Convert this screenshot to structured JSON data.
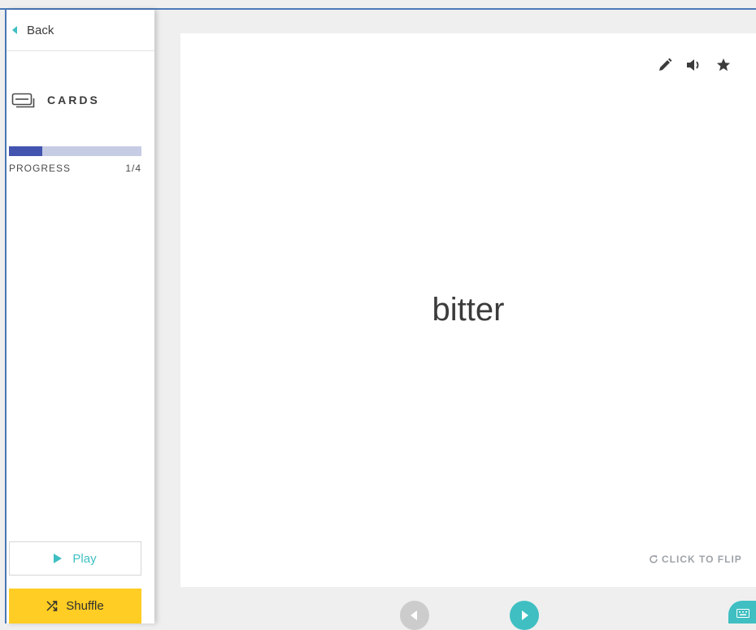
{
  "sidebar": {
    "back_label": "Back",
    "section_title": "CARDS",
    "progress": {
      "label": "PROGRESS",
      "count": "1/4",
      "fraction": 0.25
    },
    "play_label": "Play",
    "shuffle_label": "Shuffle"
  },
  "card": {
    "term": "bitter",
    "tools": [
      "pencil-icon",
      "speaker-icon",
      "star-icon"
    ],
    "flip_label": "CLICK TO FLIP"
  },
  "colors": {
    "accent": "#3fbfc2",
    "progress_fill": "#4254b0",
    "progress_track": "#c6cce4",
    "shuffle_button": "#ffcd23",
    "frame_border": "#4c7ab9"
  }
}
